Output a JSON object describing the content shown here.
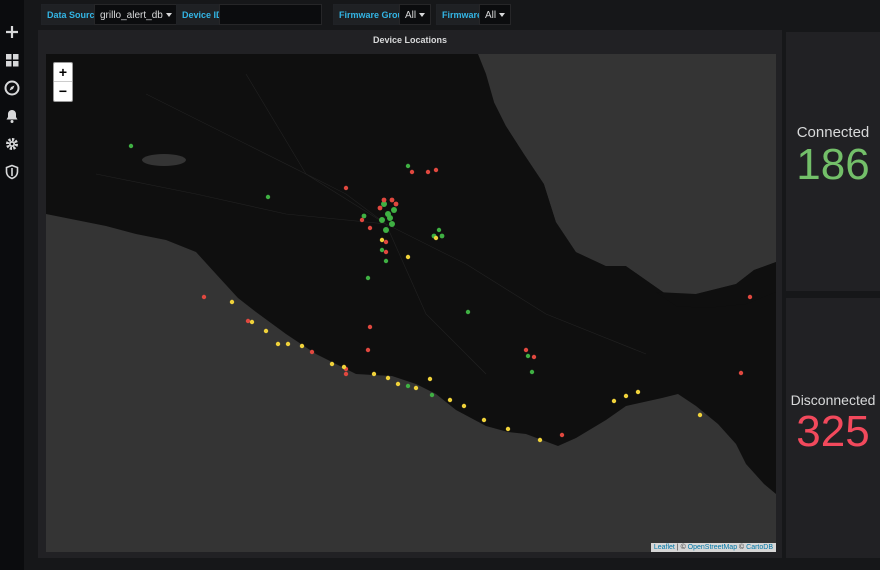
{
  "sidebar": {
    "items": [
      {
        "name": "plus-icon"
      },
      {
        "name": "dashboards-icon"
      },
      {
        "name": "explore-icon"
      },
      {
        "name": "alerting-icon"
      },
      {
        "name": "gear-icon"
      },
      {
        "name": "shield-icon"
      }
    ]
  },
  "variables": {
    "data_source": {
      "label": "Data Source",
      "value": "grillo_alert_db"
    },
    "device_id": {
      "label": "Device ID",
      "value": ""
    },
    "firmware_group": {
      "label": "Firmware Group",
      "value": "All"
    },
    "firmware": {
      "label": "Firmware",
      "value": "All"
    }
  },
  "map_panel": {
    "title": "Device Locations",
    "zoom_in": "+",
    "zoom_out": "−",
    "attribution": {
      "leaflet": "Leaflet",
      "sep1": " | © ",
      "osm": "OpenStreetMap",
      "sep2": " © ",
      "carto": "CartoDB"
    },
    "colors": {
      "connected": "#3fb043",
      "disconnected": "#e0483f",
      "warning": "#f0d23a"
    }
  },
  "stats": {
    "connected": {
      "title": "Connected",
      "value": "186",
      "color": "#73bf69"
    },
    "disconnected": {
      "title": "Disconnected",
      "value": "325",
      "color": "#f2495c"
    }
  }
}
